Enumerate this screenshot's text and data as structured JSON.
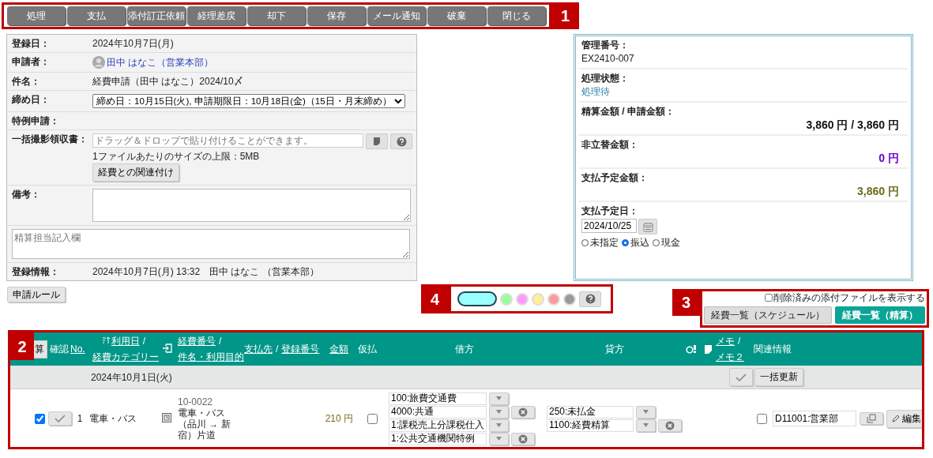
{
  "toolbar": {
    "callout": "1",
    "buttons": [
      "処理",
      "支払",
      "添付訂正依頼",
      "経理差戻",
      "却下",
      "保存",
      "メール通知",
      "破棄",
      "閉じる"
    ]
  },
  "form": {
    "rows": [
      {
        "kind": "text",
        "label": "登録日：",
        "value": "2024年10月7日(月)"
      },
      {
        "kind": "user",
        "label": "申請者：",
        "value": "田中 はなこ（営業本部）"
      },
      {
        "kind": "text",
        "label": "件名：",
        "value": "経費申請（田中 はなこ）2024/10〆"
      },
      {
        "kind": "select",
        "label": "締め日：",
        "value": "締め日：10月15日(火), 申請期限日：10月18日(金)（15日・月末締め）"
      },
      {
        "kind": "text",
        "label": "特例申請："
      },
      {
        "kind": "upload",
        "label": "一括撮影領収書：",
        "placeholder": "ドラッグ＆ドロップで貼り付けることができます。",
        "note": "1ファイルあたりのサイズの上限：5MB",
        "button": "経費との関連付け"
      },
      {
        "kind": "textarea",
        "label": "備考："
      },
      {
        "kind": "wide_textarea",
        "placeholder": "精算担当記入欄"
      },
      {
        "kind": "text",
        "label": "登録情報：",
        "value": "2024年10月7日(月) 13:32　田中 はなこ （営業本部）"
      }
    ]
  },
  "summary": {
    "items": [
      {
        "kind": "text",
        "label": "管理番号：",
        "value": "EX2410-007"
      },
      {
        "kind": "status",
        "label": "処理状態：",
        "value": "処理待"
      },
      {
        "kind": "amount",
        "label": "精算金額 / 申請金額：",
        "value": "3,860 円 / 3,860 円",
        "color": "#111111"
      },
      {
        "kind": "amount",
        "label": "非立替金額：",
        "value": "0 円",
        "color": "#6a00cc"
      },
      {
        "kind": "amount",
        "label": "支払予定金額：",
        "value": "3,860 円",
        "color": "#6b6b1a"
      },
      {
        "kind": "date",
        "label": "支払予定日：",
        "value": "2024/10/25",
        "options": [
          {
            "label": "未指定",
            "selected": false
          },
          {
            "label": "振込",
            "selected": true
          },
          {
            "label": "現金",
            "selected": false
          }
        ]
      }
    ]
  },
  "rule_button": "申請ルール",
  "color_filter": {
    "callout": "4",
    "swatches": [
      {
        "color": "#99ffff",
        "selected": true
      },
      {
        "color": "#99ff99",
        "selected": false
      },
      {
        "color": "#ff99ff",
        "selected": false
      },
      {
        "color": "#ffee99",
        "selected": false
      },
      {
        "color": "#ff9999",
        "selected": false
      },
      {
        "color": "#999999",
        "selected": false
      }
    ]
  },
  "view_switch": {
    "callout": "3",
    "show_deleted": {
      "label": "削除済みの添付ファイルを表示する",
      "checked": false
    },
    "tabs": [
      {
        "label": "経費一覧（スケジュール）",
        "selected": false
      },
      {
        "label": "経費一覧（精算）",
        "selected": true
      }
    ]
  },
  "table": {
    "callout": "2",
    "header": {
      "select_button": "算",
      "confirm": "確認",
      "no": "No.",
      "date_category": {
        "top": "利用日",
        "sep": "/",
        "bottom": "経費カテゴリー"
      },
      "number_subject": {
        "top": "経費番号",
        "sep": "/",
        "bottom": "件名・利用目的"
      },
      "payee": {
        "top": "支払先",
        "sep": "/",
        "bottom": "登録番号"
      },
      "amount": "金額",
      "advance": "仮払",
      "debit": "借方",
      "credit": "貸方",
      "memo": {
        "top": "メモ",
        "sep": "/",
        "bottom": "メモ２"
      },
      "related": "関連情報"
    },
    "group": {
      "date": "2024年10月1日(火)",
      "bulk_button": "一括更新"
    },
    "rows": [
      {
        "checked": true,
        "no": "1",
        "category": "電車・バス",
        "expense_no": "10-0022",
        "subject": "電車・バス（品川 → 新宿）片道",
        "amount": "210 円",
        "advance": false,
        "debit": [
          {
            "value": "100:旅費交通費",
            "clearable": false
          },
          {
            "value": "4000:共通",
            "clearable": true
          },
          {
            "value": "1:課税売上分課税仕入",
            "clearable": false
          },
          {
            "value": "1:公共交通機関特例",
            "clearable": true
          }
        ],
        "credit": [
          {
            "value": "250:未払金",
            "clearable": false
          },
          {
            "value": "1100:経費精算",
            "clearable": true
          }
        ],
        "related_checked": false,
        "related": "D11001:営業部",
        "edit": "編集"
      }
    ]
  }
}
